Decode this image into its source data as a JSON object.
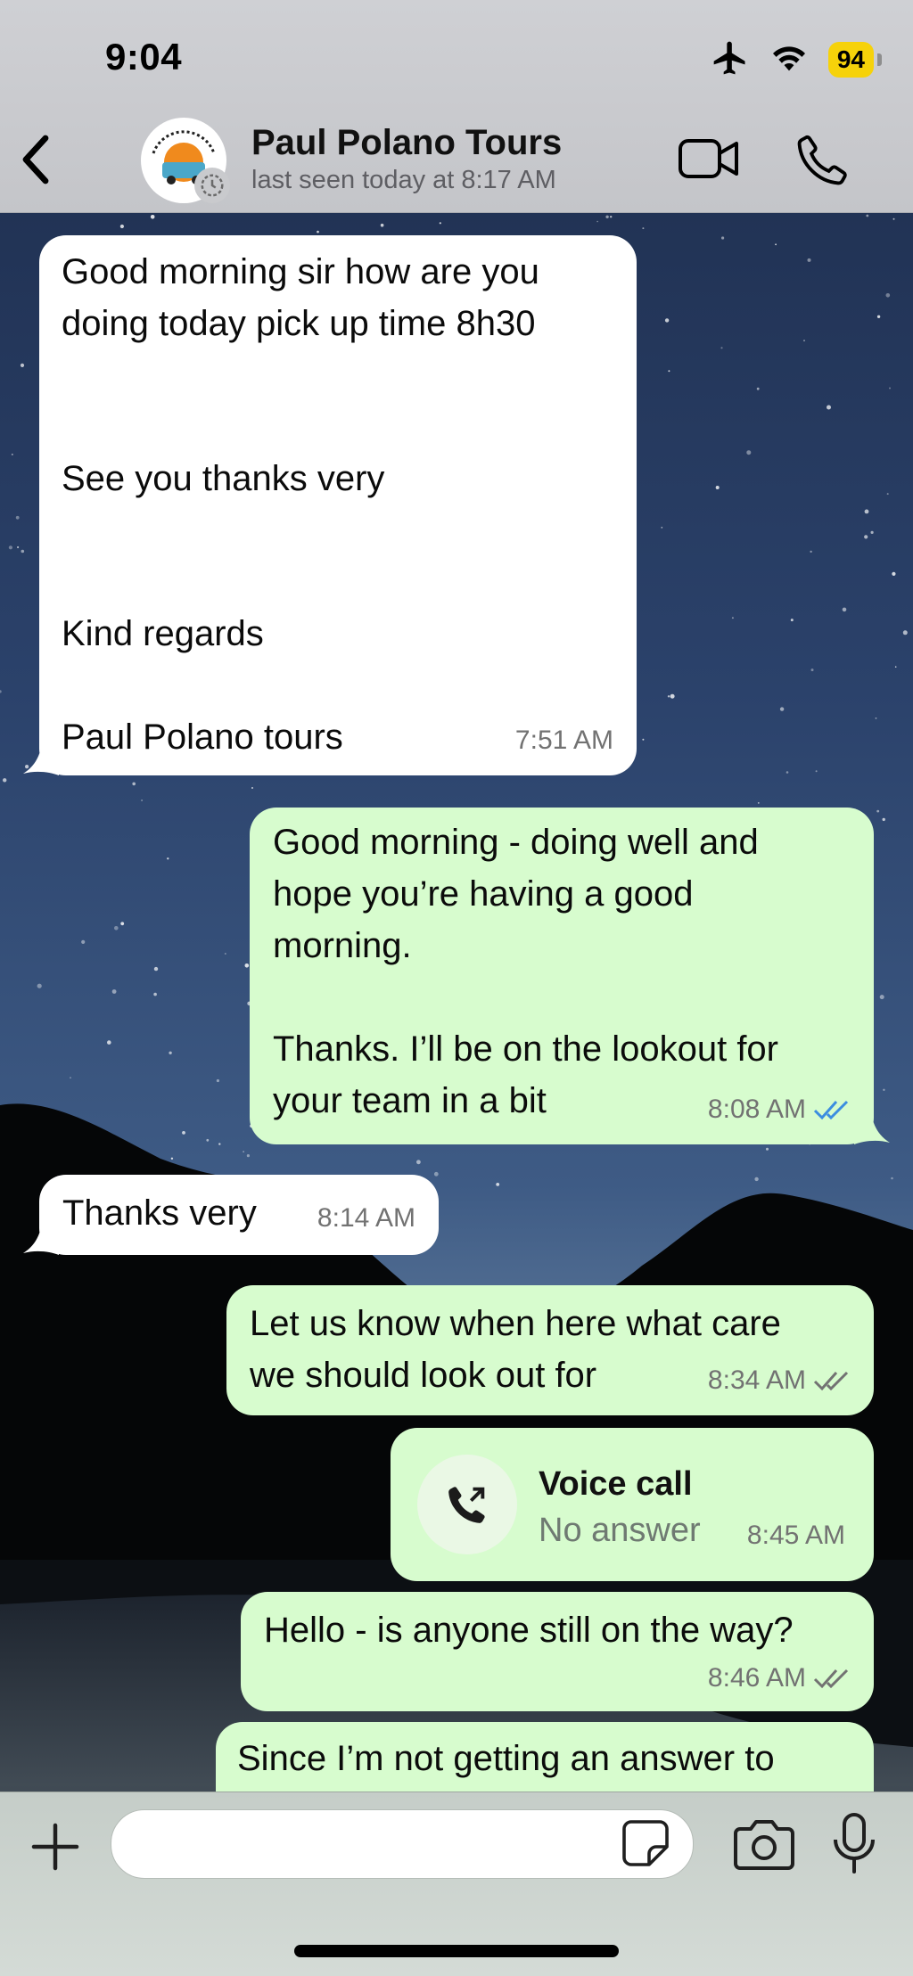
{
  "status_bar": {
    "time": "9:04",
    "battery": "94"
  },
  "header": {
    "contact_name": "Paul Polano Tours",
    "last_seen": "last seen today at 8:17 AM"
  },
  "messages": [
    {
      "direction": "in",
      "text": "Good morning sir how are you\ndoing today pick up time 8h30\n\n\nSee you thanks very\n\n\nKind regards\n\nPaul Polano tours",
      "time": "7:51 AM"
    },
    {
      "direction": "out",
      "text": "Good morning - doing well and\nhope you’re having a good\nmorning.\n\nThanks. I’ll be on the lookout for\nyour team in a bit",
      "time": "8:08 AM",
      "ticks": "read"
    },
    {
      "direction": "in",
      "text": "Thanks very",
      "time": "8:14 AM"
    },
    {
      "direction": "out",
      "text": "Let us know when here what care\nwe should look out for",
      "time": "8:34 AM",
      "ticks": "delivered"
    },
    {
      "direction": "out",
      "type": "call",
      "title": "Voice call",
      "subtitle": "No answer",
      "time": "8:45 AM"
    },
    {
      "direction": "out",
      "text": "Hello - is anyone still on the way?",
      "time": "8:46 AM",
      "ticks": "delivered"
    },
    {
      "direction": "out",
      "text": "Since I’m not getting an answer to"
    }
  ],
  "composer": {
    "placeholder": ""
  },
  "colors": {
    "incoming": "#ffffff",
    "outgoing": "#d7fcce",
    "read_tick": "#3b8de0",
    "battery": "#f6d20a"
  }
}
